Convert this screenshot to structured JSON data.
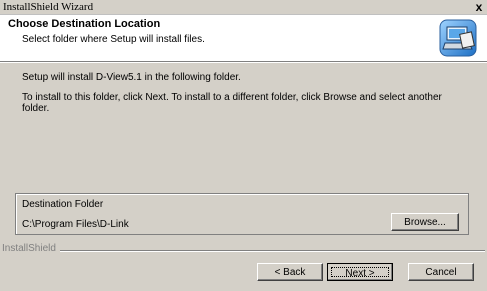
{
  "window": {
    "title": "InstallShield Wizard",
    "close_glyph": "x"
  },
  "header": {
    "title": "Choose Destination Location",
    "subtitle": "Select folder where Setup will install files.",
    "logo_icon": "computer-install-icon"
  },
  "body": {
    "line1": "Setup will install D-View5.1 in the following folder.",
    "line2": "To install to this folder, click Next. To install to a different folder, click Browse and select another folder."
  },
  "destination": {
    "legend": "Destination Folder",
    "path": "C:\\Program Files\\D-Link",
    "browse_label": "Browse..."
  },
  "footer": {
    "brand": "InstallShield",
    "back_label": "< Back",
    "next_label": "Next >",
    "cancel_label": "Cancel"
  }
}
